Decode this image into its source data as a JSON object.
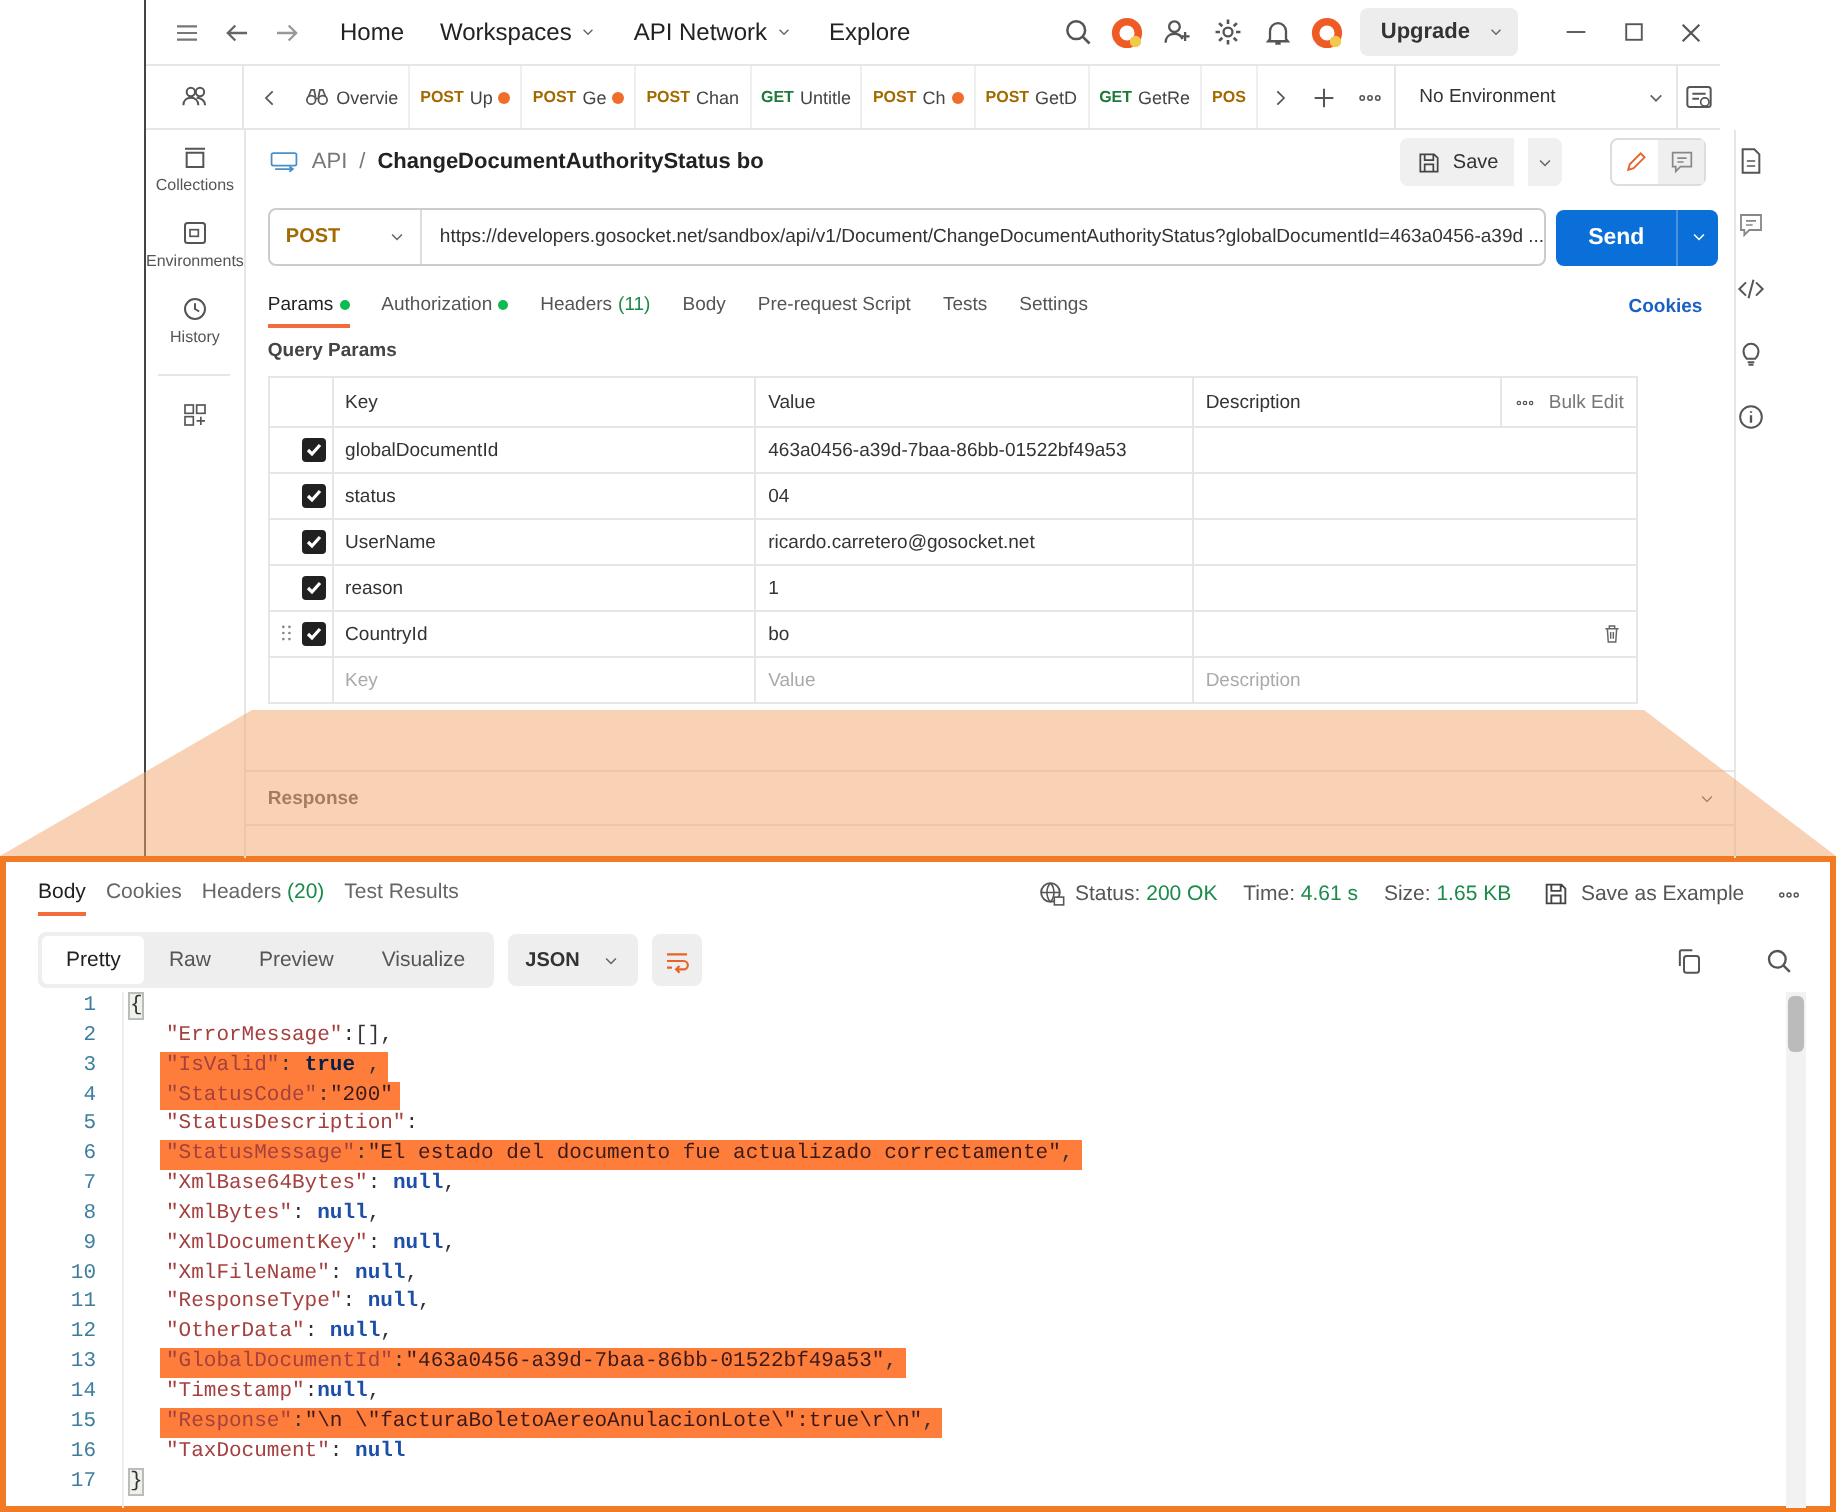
{
  "topbar": {
    "nav": [
      {
        "label": "Home",
        "dropdown": false
      },
      {
        "label": "Workspaces",
        "dropdown": true
      },
      {
        "label": "API Network",
        "dropdown": true
      },
      {
        "label": "Explore",
        "dropdown": false
      }
    ],
    "upgrade": "Upgrade"
  },
  "sidebar": [
    {
      "kind": "collections",
      "label": "Collections"
    },
    {
      "kind": "environments",
      "label": "Environments"
    },
    {
      "kind": "history",
      "label": "History"
    }
  ],
  "request_tabs": [
    {
      "kind": "overview",
      "name": "Overvie",
      "unsaved": false
    },
    {
      "kind": "request",
      "method": "POST",
      "color": "#a36a00",
      "name": "Up",
      "unsaved": true
    },
    {
      "kind": "request",
      "method": "POST",
      "color": "#a36a00",
      "name": "Ge",
      "unsaved": true
    },
    {
      "kind": "request",
      "method": "POST",
      "color": "#a36a00",
      "name": "Chan",
      "unsaved": false
    },
    {
      "kind": "request",
      "method": "GET",
      "color": "#1f7a3a",
      "name": "Untitle",
      "unsaved": false
    },
    {
      "kind": "request",
      "method": "POST",
      "color": "#a36a00",
      "name": "Ch",
      "unsaved": true
    },
    {
      "kind": "request",
      "method": "POST",
      "color": "#a36a00",
      "name": "GetD",
      "unsaved": false
    },
    {
      "kind": "request",
      "method": "GET",
      "color": "#1f7a3a",
      "name": "GetRe",
      "unsaved": false
    },
    {
      "kind": "cut",
      "method": "POS",
      "color": "#a36a00",
      "unsaved": false
    }
  ],
  "environment": "No Environment",
  "breadcrumb": {
    "collection": "API",
    "separator": "/",
    "request": "ChangeDocumentAuthorityStatus bo"
  },
  "save": "Save",
  "request": {
    "method": "POST",
    "url": "https://developers.gosocket.net/sandbox/api/v1/Document/ChangeDocumentAuthorityStatus?globalDocumentId=463a0456-a39d ...",
    "send": "Send"
  },
  "config_tabs": [
    {
      "label": "Params",
      "dot": true,
      "selected": true
    },
    {
      "label": "Authorization",
      "dot": true,
      "selected": false
    },
    {
      "label": "Headers",
      "count": "(11)",
      "dot": false,
      "selected": false
    },
    {
      "label": "Body",
      "dot": false,
      "selected": false
    },
    {
      "label": "Pre-request Script",
      "dot": false,
      "selected": false
    },
    {
      "label": "Tests",
      "dot": false,
      "selected": false
    },
    {
      "label": "Settings",
      "dot": false,
      "selected": false
    }
  ],
  "cookies": "Cookies",
  "query_params": {
    "title": "Query Params",
    "columns": [
      "Key",
      "Value",
      "Description"
    ],
    "bulk_edit": "Bulk Edit",
    "rows": [
      {
        "checked": true,
        "key": "globalDocumentId",
        "value": "463a0456-a39d-7baa-86bb-01522bf49a53",
        "hovered": false
      },
      {
        "checked": true,
        "key": "status",
        "value": "04",
        "hovered": false
      },
      {
        "checked": true,
        "key": "UserName",
        "value": "ricardo.carretero@gosocket.net",
        "hovered": false
      },
      {
        "checked": true,
        "key": "reason",
        "value": "1",
        "hovered": false
      },
      {
        "checked": true,
        "key": "CountryId",
        "value": "bo",
        "hovered": true
      }
    ],
    "new_row": {
      "key": {
        "placeholder": "Key"
      },
      "value": {
        "placeholder": "Value"
      },
      "description": {
        "placeholder": "Description"
      }
    }
  },
  "response_bar": {
    "title": "Response"
  },
  "response": {
    "tabs": [
      {
        "label": "Body",
        "selected": true
      },
      {
        "label": "Cookies",
        "selected": false
      },
      {
        "label": "Headers",
        "count": "(20)",
        "selected": false
      },
      {
        "label": "Test Results",
        "selected": false
      }
    ],
    "status": {
      "label": "Status:",
      "value": "200 OK"
    },
    "time": {
      "label": "Time:",
      "value": "4.61 s"
    },
    "size": {
      "label": "Size:",
      "value": "1.65 KB"
    },
    "save_example": "Save as Example",
    "views": [
      {
        "label": "Pretty",
        "selected": true
      },
      {
        "label": "Raw",
        "selected": false
      },
      {
        "label": "Preview",
        "selected": false
      },
      {
        "label": "Visualize",
        "selected": false
      }
    ],
    "format": "JSON",
    "lines": [
      {
        "number": "1",
        "nested": false,
        "highlighted": false,
        "parts": [
          {
            "kind": "brace",
            "text": "{"
          }
        ]
      },
      {
        "number": "2",
        "nested": true,
        "highlighted": false,
        "parts": [
          {
            "kind": "key",
            "text": "\"ErrorMessage\""
          },
          {
            "kind": "punct",
            "text": ":[],"
          }
        ]
      },
      {
        "number": "3",
        "nested": true,
        "highlighted": true,
        "parts": [
          {
            "kind": "key",
            "text": "\"IsValid\""
          },
          {
            "kind": "punct",
            "text": ": "
          },
          {
            "kind": "bool",
            "text": "true"
          },
          {
            "kind": "punct",
            "text": " ,"
          }
        ]
      },
      {
        "number": "4",
        "nested": true,
        "highlighted": true,
        "parts": [
          {
            "kind": "key",
            "text": "\"StatusCode\""
          },
          {
            "kind": "punct",
            "text": ":"
          },
          {
            "kind": "string",
            "text": "\"200\""
          }
        ]
      },
      {
        "number": "5",
        "nested": true,
        "highlighted": false,
        "parts": [
          {
            "kind": "key",
            "text": "\"StatusDescription\""
          },
          {
            "kind": "punct",
            "text": ":"
          }
        ]
      },
      {
        "number": "6",
        "nested": true,
        "highlighted": true,
        "parts": [
          {
            "kind": "key",
            "text": "\"StatusMessage\""
          },
          {
            "kind": "punct",
            "text": ":"
          },
          {
            "kind": "string",
            "text": "\"El estado del documento fue actualizado correctamente\""
          },
          {
            "kind": "punct",
            "text": ","
          }
        ]
      },
      {
        "number": "7",
        "nested": true,
        "highlighted": false,
        "parts": [
          {
            "kind": "key",
            "text": "\"XmlBase64Bytes\""
          },
          {
            "kind": "punct",
            "text": ": "
          },
          {
            "kind": "null",
            "text": "null"
          },
          {
            "kind": "punct",
            "text": ","
          }
        ]
      },
      {
        "number": "8",
        "nested": true,
        "highlighted": false,
        "parts": [
          {
            "kind": "key",
            "text": "\"XmlBytes\""
          },
          {
            "kind": "punct",
            "text": ": "
          },
          {
            "kind": "null",
            "text": "null"
          },
          {
            "kind": "punct",
            "text": ","
          }
        ]
      },
      {
        "number": "9",
        "nested": true,
        "highlighted": false,
        "parts": [
          {
            "kind": "key",
            "text": "\"XmlDocumentKey\""
          },
          {
            "kind": "punct",
            "text": ": "
          },
          {
            "kind": "null",
            "text": "null"
          },
          {
            "kind": "punct",
            "text": ","
          }
        ]
      },
      {
        "number": "10",
        "nested": true,
        "highlighted": false,
        "parts": [
          {
            "kind": "key",
            "text": "\"XmlFileName\""
          },
          {
            "kind": "punct",
            "text": ": "
          },
          {
            "kind": "null",
            "text": "null"
          },
          {
            "kind": "punct",
            "text": ","
          }
        ]
      },
      {
        "number": "11",
        "nested": true,
        "highlighted": false,
        "parts": [
          {
            "kind": "key",
            "text": "\"ResponseType\""
          },
          {
            "kind": "punct",
            "text": ": "
          },
          {
            "kind": "null",
            "text": "null"
          },
          {
            "kind": "punct",
            "text": ","
          }
        ]
      },
      {
        "number": "12",
        "nested": true,
        "highlighted": false,
        "parts": [
          {
            "kind": "key",
            "text": "\"OtherData\""
          },
          {
            "kind": "punct",
            "text": ": "
          },
          {
            "kind": "null",
            "text": "null"
          },
          {
            "kind": "punct",
            "text": ","
          }
        ]
      },
      {
        "number": "13",
        "nested": true,
        "highlighted": true,
        "parts": [
          {
            "kind": "key",
            "text": "\"GlobalDocumentId\""
          },
          {
            "kind": "punct",
            "text": ":"
          },
          {
            "kind": "string",
            "text": "\"463a0456-a39d-7baa-86bb-01522bf49a53\""
          },
          {
            "kind": "punct",
            "text": ","
          }
        ]
      },
      {
        "number": "14",
        "nested": true,
        "highlighted": false,
        "parts": [
          {
            "kind": "key",
            "text": "\"Timestamp\""
          },
          {
            "kind": "punct",
            "text": ":"
          },
          {
            "kind": "null",
            "text": "null"
          },
          {
            "kind": "punct",
            "text": ","
          }
        ]
      },
      {
        "number": "15",
        "nested": true,
        "highlighted": true,
        "parts": [
          {
            "kind": "key",
            "text": "\"Response\""
          },
          {
            "kind": "punct",
            "text": ":"
          },
          {
            "kind": "string",
            "text": "\"\\n \\\"facturaBoletoAereoAnulacionLote\\\":true\\r\\n\""
          },
          {
            "kind": "punct",
            "text": ","
          }
        ]
      },
      {
        "number": "16",
        "nested": true,
        "highlighted": false,
        "parts": [
          {
            "kind": "key",
            "text": "\"TaxDocument\""
          },
          {
            "kind": "punct",
            "text": ": "
          },
          {
            "kind": "null",
            "text": "null"
          }
        ]
      },
      {
        "number": "17",
        "nested": false,
        "highlighted": false,
        "parts": [
          {
            "kind": "brace",
            "text": "}"
          }
        ]
      }
    ]
  }
}
